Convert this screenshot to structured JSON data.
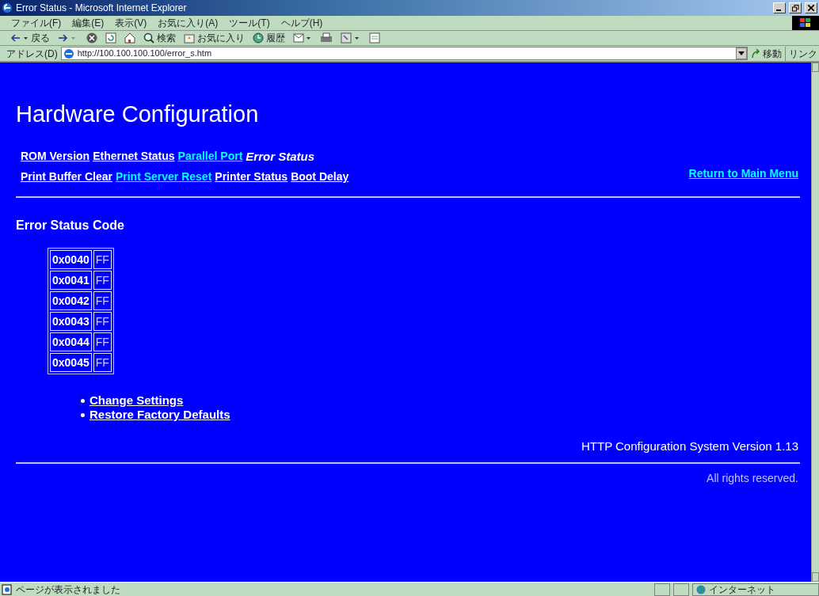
{
  "window": {
    "title": "Error Status - Microsoft Internet Explorer"
  },
  "menu": [
    "ファイル(F)",
    "編集(E)",
    "表示(V)",
    "お気に入り(A)",
    "ツール(T)",
    "ヘルプ(H)"
  ],
  "toolbar": {
    "back": "戻る",
    "search": "検索",
    "favorites": "お気に入り",
    "history": "履歴"
  },
  "address_bar": {
    "label": "アドレス(D)",
    "value": "http://100.100.100.100/error_s.htm",
    "go": "移動",
    "links": "リンク"
  },
  "page": {
    "heading": "Hardware Configuration",
    "nav_rows": [
      [
        {
          "label": "ROM Version",
          "kind": "link",
          "visited": false
        },
        {
          "label": "Ethernet Status",
          "kind": "link",
          "visited": false
        },
        {
          "label": "Parallel Port",
          "kind": "link",
          "visited": true
        },
        {
          "label": "Error Status",
          "kind": "current",
          "visited": false
        }
      ],
      [
        {
          "label": "Print Buffer Clear",
          "kind": "link",
          "visited": false
        },
        {
          "label": "Print Server Reset",
          "kind": "link",
          "visited": true
        },
        {
          "label": "Printer Status",
          "kind": "link",
          "visited": false
        },
        {
          "label": "Boot Delay",
          "kind": "link",
          "visited": false
        }
      ]
    ],
    "return_link": {
      "label": "Return to Main Menu",
      "visited": true
    },
    "section_title": "Error Status Code",
    "codes": [
      {
        "code": "0x0040",
        "value": "FF"
      },
      {
        "code": "0x0041",
        "value": "FF"
      },
      {
        "code": "0x0042",
        "value": "FF"
      },
      {
        "code": "0x0043",
        "value": "FF"
      },
      {
        "code": "0x0044",
        "value": "FF"
      },
      {
        "code": "0x0045",
        "value": "FF"
      }
    ],
    "actions": [
      "Change Settings",
      "Restore Factory Defaults"
    ],
    "version": "HTTP Configuration System Version 1.13",
    "copyright": "All rights reserved."
  },
  "status_bar": {
    "message": "ページが表示されました",
    "zone": "インターネット"
  }
}
